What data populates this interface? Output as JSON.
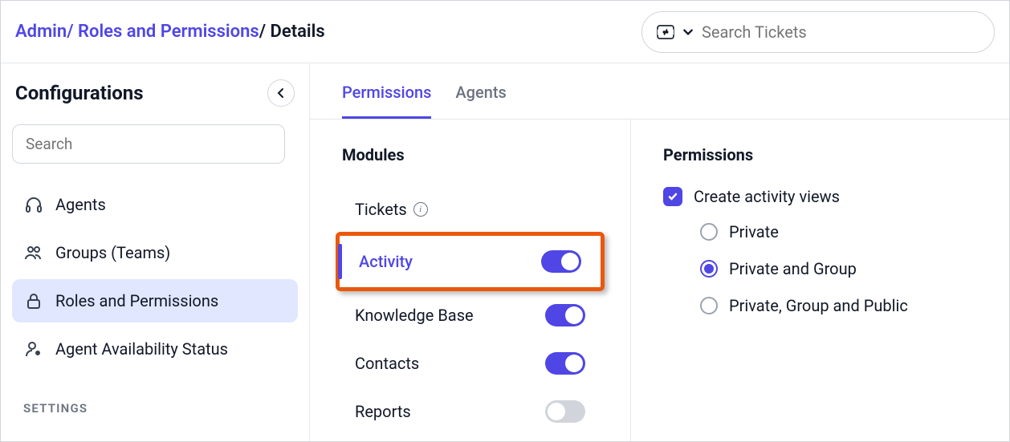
{
  "breadcrumb": {
    "part1": "Admin",
    "part2": "Roles and Permissions",
    "part3": "Details"
  },
  "search": {
    "placeholder": "Search Tickets"
  },
  "sidebar": {
    "title": "Configurations",
    "search_placeholder": "Search",
    "items": [
      {
        "label": "Agents"
      },
      {
        "label": "Groups (Teams)"
      },
      {
        "label": "Roles and Permissions"
      },
      {
        "label": "Agent Availability Status"
      }
    ],
    "settings_heading": "SETTINGS"
  },
  "tabs": [
    {
      "label": "Permissions"
    },
    {
      "label": "Agents"
    }
  ],
  "modules": {
    "heading": "Modules",
    "items": [
      {
        "label": "Tickets",
        "info": true,
        "toggle": null
      },
      {
        "label": "Activity",
        "highlighted": true,
        "selected": true,
        "toggle": true
      },
      {
        "label": "Knowledge Base",
        "toggle": true
      },
      {
        "label": "Contacts",
        "toggle": true
      },
      {
        "label": "Reports",
        "toggle": false
      }
    ]
  },
  "permissions": {
    "heading": "Permissions",
    "check_label": "Create activity views",
    "checked": true,
    "options": [
      {
        "label": "Private",
        "checked": false
      },
      {
        "label": "Private and Group",
        "checked": true
      },
      {
        "label": "Private, Group and Public",
        "checked": false
      }
    ]
  }
}
